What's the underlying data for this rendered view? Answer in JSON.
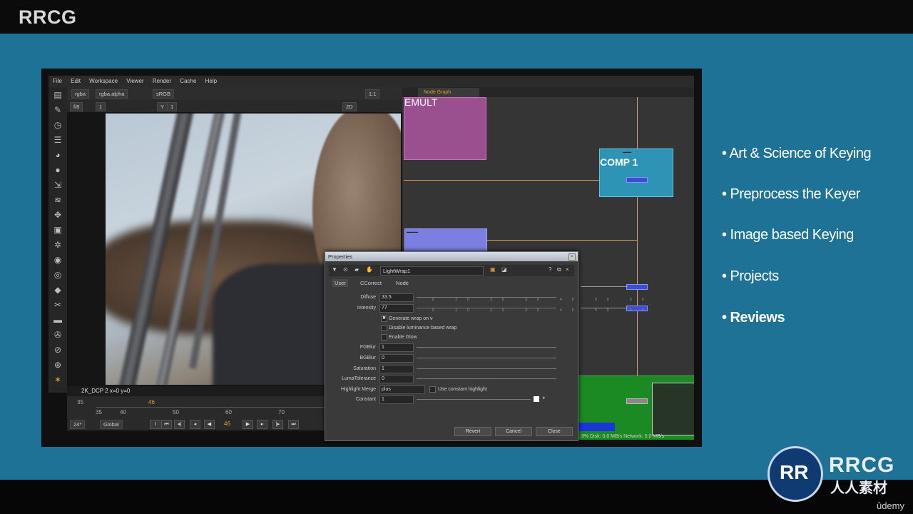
{
  "site_logo": "RRCG",
  "menu": [
    "File",
    "Edit",
    "Workspace",
    "Viewer",
    "Render",
    "Cache",
    "Help"
  ],
  "viewer": {
    "channels": "rgba",
    "alpha": "rgba.alpha",
    "colorspace": "sRGB",
    "zoom": "1:1",
    "frame_label": "f/8",
    "frame_value": "1",
    "y_label": "Y",
    "y_value": "1",
    "view_mode": "2D",
    "format_status": "2K_DCP 2  x=0 y=0"
  },
  "timeline": {
    "start": "35",
    "ticks": [
      "35",
      "40",
      "50",
      "60",
      "70"
    ],
    "current_marker": "46",
    "fps": "24*",
    "scope": "Global",
    "frame": "46"
  },
  "node_graph": {
    "tab": "Node Graph",
    "premult_label": "EMULT",
    "comp_label": "COMP 1",
    "status": ".9% Disk: 0.0 MB/s Network: 0.0 MB/s"
  },
  "properties": {
    "title": "Properties",
    "node_name": "LightWrap1",
    "tabs": [
      "User",
      "CCorrect",
      "Node"
    ],
    "rows": {
      "diffuse": {
        "label": "Diffuse",
        "value": "33.5"
      },
      "intensity": {
        "label": "Intensity",
        "value": "77"
      },
      "generate_wrap": {
        "label": "Generate wrap on v",
        "checked": true
      },
      "disable_lum": {
        "label": "Disable luminance based wrap",
        "checked": false
      },
      "enable_glow": {
        "label": "Enable Glow",
        "checked": false
      },
      "fgblur": {
        "label": "FGBlur",
        "value": "1"
      },
      "bgblur": {
        "label": "BGBlur",
        "value": "0"
      },
      "saturation": {
        "label": "Saturation",
        "value": "1"
      },
      "luma_tolerance": {
        "label": "LumaTolerance",
        "value": "0"
      },
      "highlight_merge": {
        "label": "Highlight Merge",
        "value": "plus"
      },
      "use_constant_highlight": {
        "label": "Use constant highlight",
        "checked": false
      },
      "constant": {
        "label": "Constant",
        "value": "1"
      }
    },
    "buttons": {
      "revert": "Revert",
      "cancel": "Cancel",
      "close": "Close"
    }
  },
  "bullets": [
    {
      "text": "• Art & Science of Keying",
      "bold": false
    },
    {
      "text": "• Preprocess the Keyer",
      "bold": false
    },
    {
      "text": "• Image based Keying",
      "bold": false
    },
    {
      "text": "• Projects",
      "bold": false
    },
    {
      "text": "• Reviews",
      "bold": true
    }
  ],
  "brand": {
    "name": "RRCG",
    "chinese": "人人素材",
    "mark": "RR",
    "platform": "ûdemy"
  },
  "colors": {
    "slide_bg": "#1e7296",
    "accent_orange": "#e39b37",
    "comp_node": "#2d94b5",
    "premult_node": "#9a4f8f"
  }
}
